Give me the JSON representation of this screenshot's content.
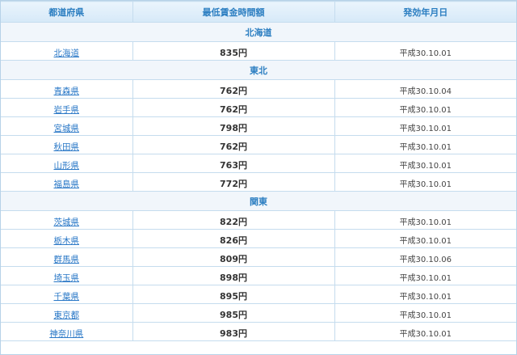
{
  "table": {
    "headers": {
      "prefecture": "都道府県",
      "min_wage": "最低賃金時間額",
      "effective_date": "発効年月日"
    },
    "regions": [
      {
        "name": "北海道",
        "rows": [
          {
            "prefecture": "北海道",
            "wage": "835円",
            "date": "平成30.10.01"
          }
        ]
      },
      {
        "name": "東北",
        "rows": [
          {
            "prefecture": "青森県",
            "wage": "762円",
            "date": "平成30.10.04"
          },
          {
            "prefecture": "岩手県",
            "wage": "762円",
            "date": "平成30.10.01"
          },
          {
            "prefecture": "宮城県",
            "wage": "798円",
            "date": "平成30.10.01"
          },
          {
            "prefecture": "秋田県",
            "wage": "762円",
            "date": "平成30.10.01"
          },
          {
            "prefecture": "山形県",
            "wage": "763円",
            "date": "平成30.10.01"
          },
          {
            "prefecture": "福島県",
            "wage": "772円",
            "date": "平成30.10.01"
          }
        ]
      },
      {
        "name": "関東",
        "rows": [
          {
            "prefecture": "茨城県",
            "wage": "822円",
            "date": "平成30.10.01"
          },
          {
            "prefecture": "栃木県",
            "wage": "826円",
            "date": "平成30.10.01"
          },
          {
            "prefecture": "群馬県",
            "wage": "809円",
            "date": "平成30.10.06"
          },
          {
            "prefecture": "埼玉県",
            "wage": "898円",
            "date": "平成30.10.01"
          },
          {
            "prefecture": "千葉県",
            "wage": "895円",
            "date": "平成30.10.01"
          },
          {
            "prefecture": "東京都",
            "wage": "985円",
            "date": "平成30.10.01"
          },
          {
            "prefecture": "神奈川県",
            "wage": "983円",
            "date": "平成30.10.01"
          }
        ]
      }
    ]
  }
}
